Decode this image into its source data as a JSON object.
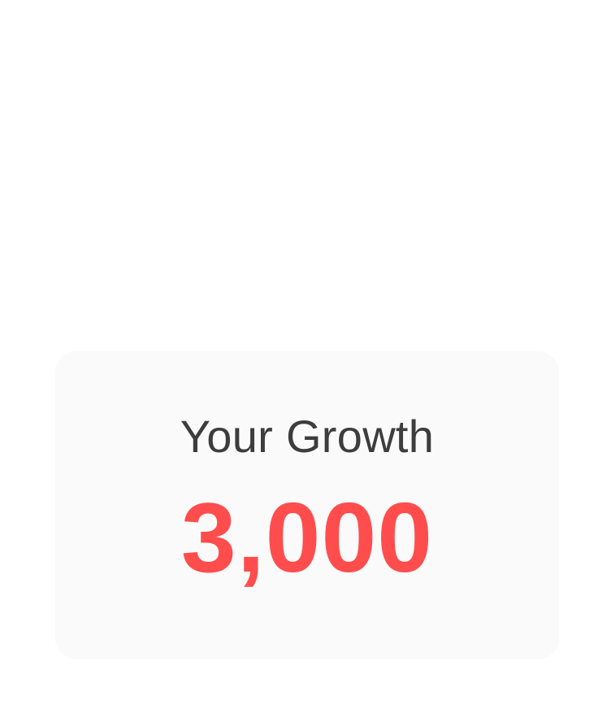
{
  "card": {
    "title": "Your Growth",
    "value": "3,000"
  },
  "colors": {
    "value": "#ff4d4d",
    "title": "#3d3d3d",
    "card_background": "#fafafa"
  }
}
